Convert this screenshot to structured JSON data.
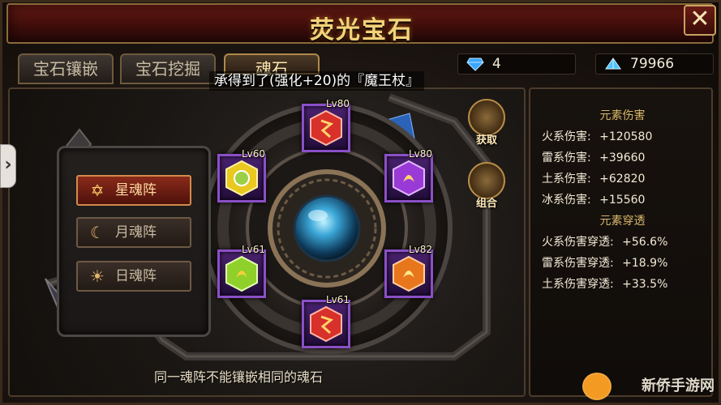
{
  "window": {
    "title": "荧光宝石",
    "close_label": "✕"
  },
  "tabs": [
    {
      "label": "宝石镶嵌",
      "active": false
    },
    {
      "label": "宝石挖掘",
      "active": false
    },
    {
      "label": "魂石",
      "active": true
    }
  ],
  "currencies": [
    {
      "icon": "diamond-icon",
      "value": "4"
    },
    {
      "icon": "crystal-icon",
      "value": "79966"
    }
  ],
  "notice": "承得到了(强化+20)的『魔王杖』",
  "formations": [
    {
      "icon": "star-icon",
      "label": "星魂阵",
      "active": true
    },
    {
      "icon": "moon-icon",
      "label": "月魂阵",
      "active": false
    },
    {
      "icon": "sun-icon",
      "label": "日魂阵",
      "active": false
    }
  ],
  "sockets": [
    {
      "name": "socket-top",
      "level": "Lv80",
      "gem_color": "#d8302a"
    },
    {
      "name": "socket-upper-left",
      "level": "Lv60",
      "gem_color": "#e9c820"
    },
    {
      "name": "socket-upper-right",
      "level": "Lv80",
      "gem_color": "#9a3ad6"
    },
    {
      "name": "socket-lower-left",
      "level": "Lv61",
      "gem_color": "#8fd02a"
    },
    {
      "name": "socket-lower-right",
      "level": "Lv82",
      "gem_color": "#e8761c"
    },
    {
      "name": "socket-bottom",
      "level": "Lv61",
      "gem_color": "#d8302a"
    }
  ],
  "actions": [
    {
      "label": "获取"
    },
    {
      "label": "组合"
    }
  ],
  "bottom_note": "同一魂阵不能镶嵌相同的魂石",
  "stats": {
    "damage_header": "元素伤害",
    "damage": [
      {
        "label": "火系伤害:",
        "value": "+120580"
      },
      {
        "label": "雷系伤害:",
        "value": "+39660"
      },
      {
        "label": "土系伤害:",
        "value": "+62820"
      },
      {
        "label": "冰系伤害:",
        "value": "+15560"
      }
    ],
    "penetration_header": "元素穿透",
    "penetration": [
      {
        "label": "火系伤害穿透:",
        "value": "+56.6%"
      },
      {
        "label": "雷系伤害穿透:",
        "value": "+18.9%"
      },
      {
        "label": "土系伤害穿透:",
        "value": "+33.5%"
      }
    ]
  },
  "watermark": "新侨手游网"
}
